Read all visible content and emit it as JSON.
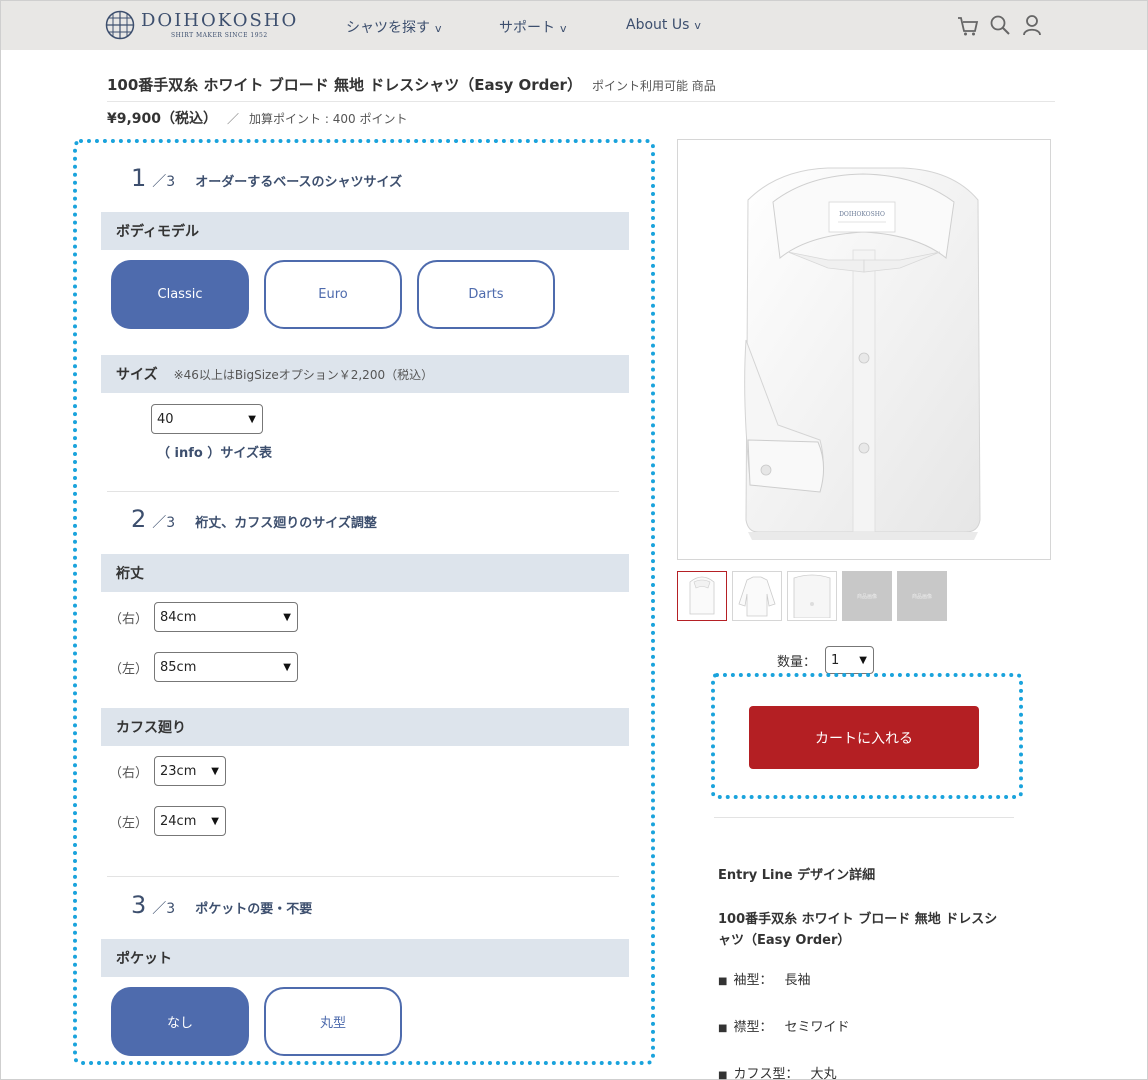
{
  "header": {
    "brand": "DOIHOKOSHO",
    "brand_sub": "SHIRT MAKER SINCE 1952",
    "nav": [
      {
        "label": "シャツを探す",
        "chev": "v"
      },
      {
        "label": "サポート",
        "chev": "v"
      },
      {
        "label": "About Us",
        "chev": "v"
      }
    ],
    "icons": [
      "cart-icon",
      "search-icon",
      "user-icon"
    ]
  },
  "product": {
    "title": "100番手双糸 ホワイト ブロード 無地 ドレスシャツ（Easy Order）",
    "tags": "ポイント利用可能 商品",
    "price": "¥9,900（税込）",
    "slash": "／",
    "points": "加算ポイント : 400 ポイント"
  },
  "config": {
    "step1": {
      "num": "1",
      "of": "／3",
      "label": "オーダーするベースのシャツサイズ"
    },
    "body_model": {
      "title": "ボディモデル",
      "options": [
        "Classic",
        "Euro",
        "Darts"
      ],
      "selected": "Classic"
    },
    "size": {
      "title": "サイズ",
      "note": "※46以上はBigSizeオプション￥2,200（税込）",
      "value": "40",
      "info_link": "（ info ）サイズ表"
    },
    "step2": {
      "num": "2",
      "of": "／3",
      "label": "裄丈、カフス廻りのサイズ調整"
    },
    "sleeve": {
      "title": "裄丈",
      "right_label": "（右）",
      "right_value": "84cm",
      "left_label": "（左）",
      "left_value": "85cm"
    },
    "cuff": {
      "title": "カフス廻り",
      "right_label": "（右）",
      "right_value": "23cm",
      "left_label": "（左）",
      "left_value": "24cm"
    },
    "step3": {
      "num": "3",
      "of": "／3",
      "label": "ポケットの要・不要"
    },
    "pocket": {
      "title": "ポケット",
      "options": [
        "なし",
        "丸型"
      ],
      "selected": "なし"
    }
  },
  "gallery": {
    "main_alt": "white dress shirt",
    "thumb_placeholder": "商品画像"
  },
  "purchase": {
    "qty_label": "数量：",
    "qty_value": "1",
    "cart_button": "カートに入れる"
  },
  "details": {
    "heading": "Entry Line デザイン詳細",
    "name": "100番手双糸 ホワイト ブロード 無地 ドレスシャツ（Easy Order）",
    "specs": [
      {
        "label": "袖型：",
        "value": "長袖"
      },
      {
        "label": "襟型：",
        "value": "セミワイド"
      },
      {
        "label": "カフス型：",
        "value": "大丸"
      }
    ],
    "bullet": "■"
  },
  "colors": {
    "accent_blue": "#4e6bad",
    "cart_red": "#b41f23",
    "dotted_cyan": "#1aa3dc",
    "section_bg": "#dde4ec"
  }
}
